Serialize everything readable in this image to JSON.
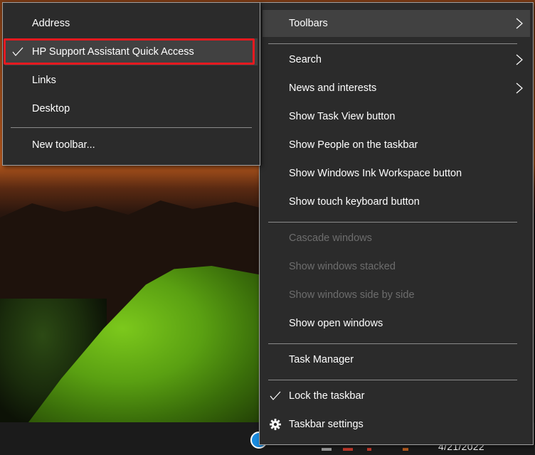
{
  "desktop": {
    "wallpaper": "night tent camping scene with mountains at sunset"
  },
  "main_menu": {
    "items": [
      {
        "label": "Toolbars",
        "has_submenu": true,
        "highlighted": true
      },
      {
        "label": "Search",
        "has_submenu": true
      },
      {
        "label": "News and interests",
        "has_submenu": true
      },
      {
        "label": "Show Task View button"
      },
      {
        "label": "Show People on the taskbar"
      },
      {
        "label": "Show Windows Ink Workspace button"
      },
      {
        "label": "Show touch keyboard button"
      },
      {
        "label": "Cascade windows",
        "disabled": true
      },
      {
        "label": "Show windows stacked",
        "disabled": true
      },
      {
        "label": "Show windows side by side",
        "disabled": true
      },
      {
        "label": "Show open windows"
      },
      {
        "label": "Task Manager"
      },
      {
        "label": "Lock the taskbar",
        "checked": true
      },
      {
        "label": "Taskbar settings",
        "icon": "gear-icon"
      }
    ]
  },
  "toolbars_submenu": {
    "items": [
      {
        "label": "Address"
      },
      {
        "label": "HP Support Assistant Quick Access",
        "checked": true,
        "highlighted": true,
        "annotated": true
      },
      {
        "label": "Links"
      },
      {
        "label": "Desktop"
      },
      {
        "label": "New toolbar..."
      }
    ]
  },
  "annotation": {
    "color": "#e8191f",
    "target": "HP Support Assistant Quick Access"
  },
  "taskbar": {
    "date": "4/21/2022",
    "tray_icon": "hp-support-assistant-icon"
  },
  "colors": {
    "menu_bg": "#2b2b2b",
    "highlight_bg": "#414141",
    "text": "#ffffff",
    "disabled_text": "#6d6d6d",
    "separator": "#8a8a8a"
  }
}
